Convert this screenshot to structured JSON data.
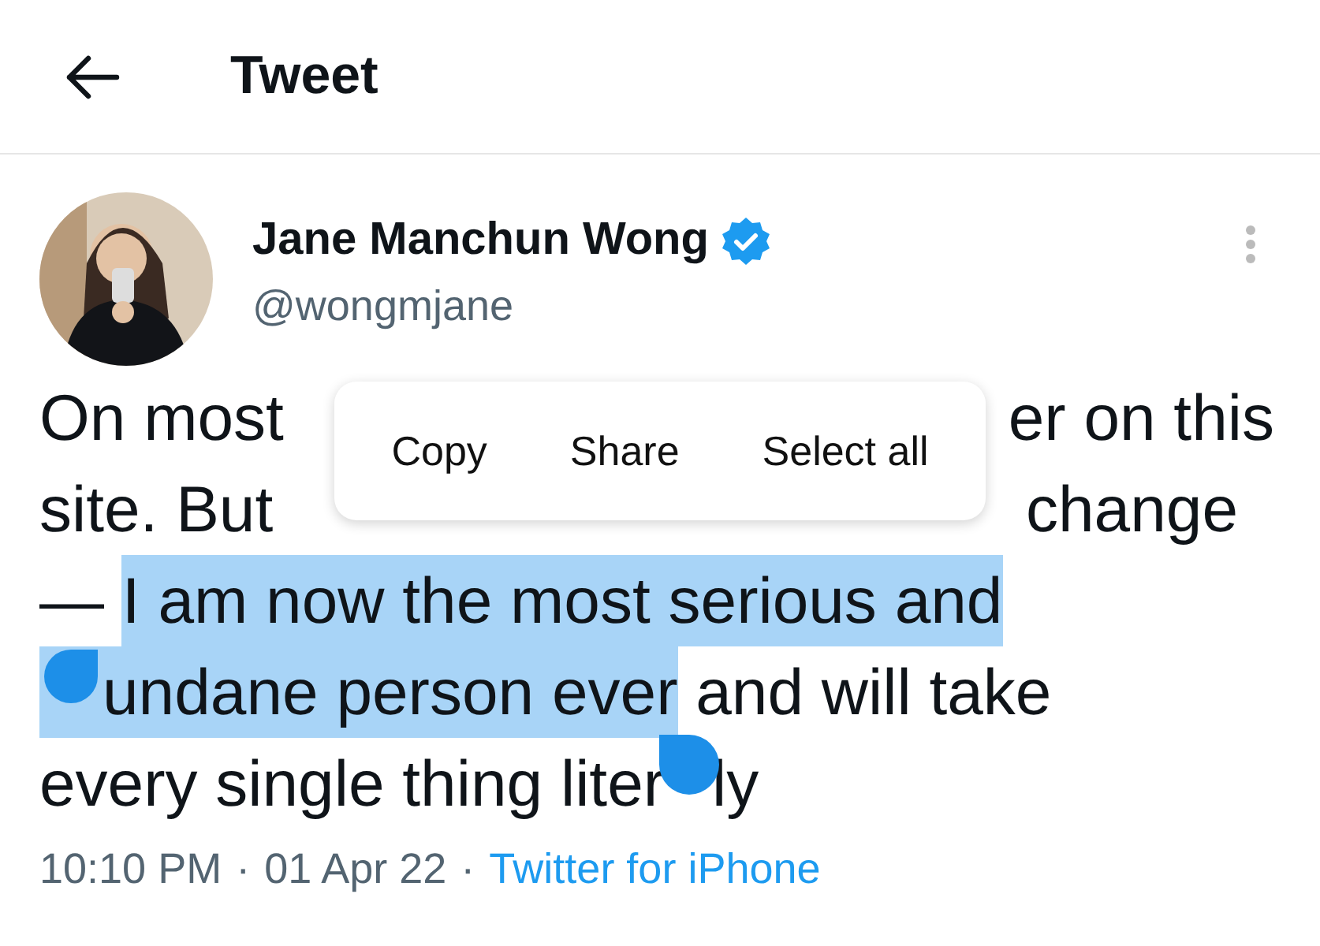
{
  "header": {
    "title": "Tweet"
  },
  "author": {
    "name": "Jane Manchun Wong",
    "verified": true,
    "handle": "@wongmjane"
  },
  "tweet_lines": [
    {
      "segments": [
        {
          "kind": "text",
          "text": "On most",
          "selected": false
        },
        {
          "kind": "covered"
        },
        {
          "kind": "text",
          "text": "er on this",
          "selected": false
        }
      ]
    },
    {
      "segments": [
        {
          "kind": "text",
          "text": "site. But",
          "selected": false
        },
        {
          "kind": "covered"
        },
        {
          "kind": "text",
          "text": "change",
          "selected": false
        }
      ]
    },
    {
      "segments": [
        {
          "kind": "text",
          "text": "— ",
          "selected": false
        },
        {
          "kind": "text",
          "text": "I am now the most serious and",
          "selected": true
        }
      ]
    },
    {
      "segments": [
        {
          "kind": "covered",
          "selected": true
        },
        {
          "kind": "text",
          "text": "undane person ever",
          "selected": true
        },
        {
          "kind": "text",
          "text": " and will take",
          "selected": false
        }
      ]
    },
    {
      "segments": [
        {
          "kind": "text",
          "text": "every single thing liter",
          "selected": false
        },
        {
          "kind": "covered",
          "selected": false
        },
        {
          "kind": "text",
          "text": "ly",
          "selected": false
        }
      ]
    }
  ],
  "context_menu": [
    "Copy",
    "Share",
    "Select all"
  ],
  "meta": {
    "time": "10:10 PM",
    "separator_1": "·",
    "date": "01 Apr 22",
    "separator_2": "·",
    "source": "Twitter for iPhone"
  }
}
